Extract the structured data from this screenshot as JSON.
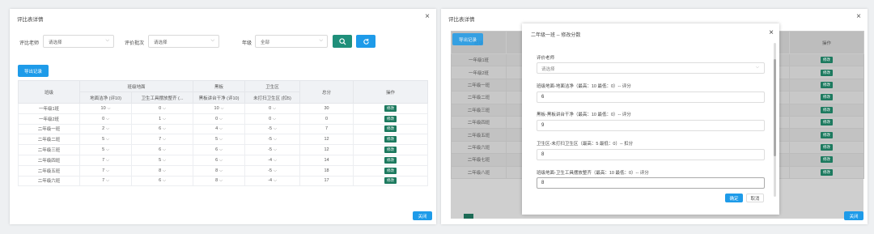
{
  "left": {
    "title": "评比表详情",
    "close_icon": "×",
    "filters": {
      "teacher_label": "评比老师",
      "teacher_placeholder": "请选择",
      "batch_label": "评价批次",
      "batch_placeholder": "请选择",
      "grade_label": "年级",
      "grade_value": "全部"
    },
    "search_icon": "search-icon",
    "refresh_icon": "refresh-icon",
    "export_label": "导出记录",
    "table": {
      "class_header": "班级",
      "group1": "班级地面",
      "group1_sub": "地面洁净 (评10)",
      "group1_sub2": "卫生工具摆放整齐 (...",
      "group2": "黑板",
      "group2_sub": "黑板讲台干净 (评10)",
      "group3": "卫生区",
      "group3_sub": "未打扫卫生区 (扣5)",
      "total_header": "总分",
      "action_header": "操作",
      "edit_label": "修改",
      "rows": [
        {
          "cls": "一年级1班",
          "a": "10",
          "b": "0",
          "c": "10",
          "d": "0",
          "total": "30"
        },
        {
          "cls": "一年级2班",
          "a": "0",
          "b": "1",
          "c": "0",
          "d": "0",
          "total": "0"
        },
        {
          "cls": "二年级一班",
          "a": "2",
          "b": "6",
          "c": "4",
          "d": "-5",
          "total": "7"
        },
        {
          "cls": "二年级二班",
          "a": "5",
          "b": "7",
          "c": "5",
          "d": "-5",
          "total": "12"
        },
        {
          "cls": "二年级三班",
          "a": "5",
          "b": "6",
          "c": "6",
          "d": "-5",
          "total": "12"
        },
        {
          "cls": "二年级四班",
          "a": "7",
          "b": "5",
          "c": "6",
          "d": "-4",
          "total": "14"
        },
        {
          "cls": "二年级五班",
          "a": "7",
          "b": "8",
          "c": "8",
          "d": "-5",
          "total": "18"
        },
        {
          "cls": "二年级六班",
          "a": "7",
          "b": "6",
          "c": "8",
          "d": "-4",
          "total": "17"
        }
      ]
    },
    "close_button": "关闭"
  },
  "right": {
    "title": "评比表详情",
    "close_icon": "×",
    "export_label": "导出记录",
    "bg_table": {
      "class_header": "班级",
      "action_header": "操作",
      "edit_label": "修改",
      "rows": [
        "一年级1班",
        "一年级2班",
        "二年级一班",
        "二年级二班",
        "二年级三班",
        "二年级四班",
        "二年级五班",
        "二年级六班",
        "二年级七班",
        "二年级八班"
      ]
    },
    "modal": {
      "title": "二年级一班 -- 修改分数",
      "close_icon": "×",
      "teacher_label": "评价老师",
      "teacher_placeholder": "请选择",
      "field1_label": "班级地面-地面洁净（最高：10 最低：0）-- 评分",
      "field1_value": "6",
      "field2_label": "黑板-黑板讲台干净（最高：10 最低：0）-- 评分",
      "field2_value": "9",
      "field3_label": "卫生区-未打扫卫生区（最高：5 最低：0）-- 扣分",
      "field3_value": "8",
      "field4_label": "班级地面-卫生工具摆放整齐（最高：10 最低：0）-- 评分",
      "field4_value": "8",
      "confirm_label": "确定",
      "cancel_label": "取消"
    },
    "close_button": "关闭"
  },
  "colors": {
    "primary": "#1e9be9",
    "teal": "#1f8f7a",
    "edit_green": "#1d7a5f"
  }
}
